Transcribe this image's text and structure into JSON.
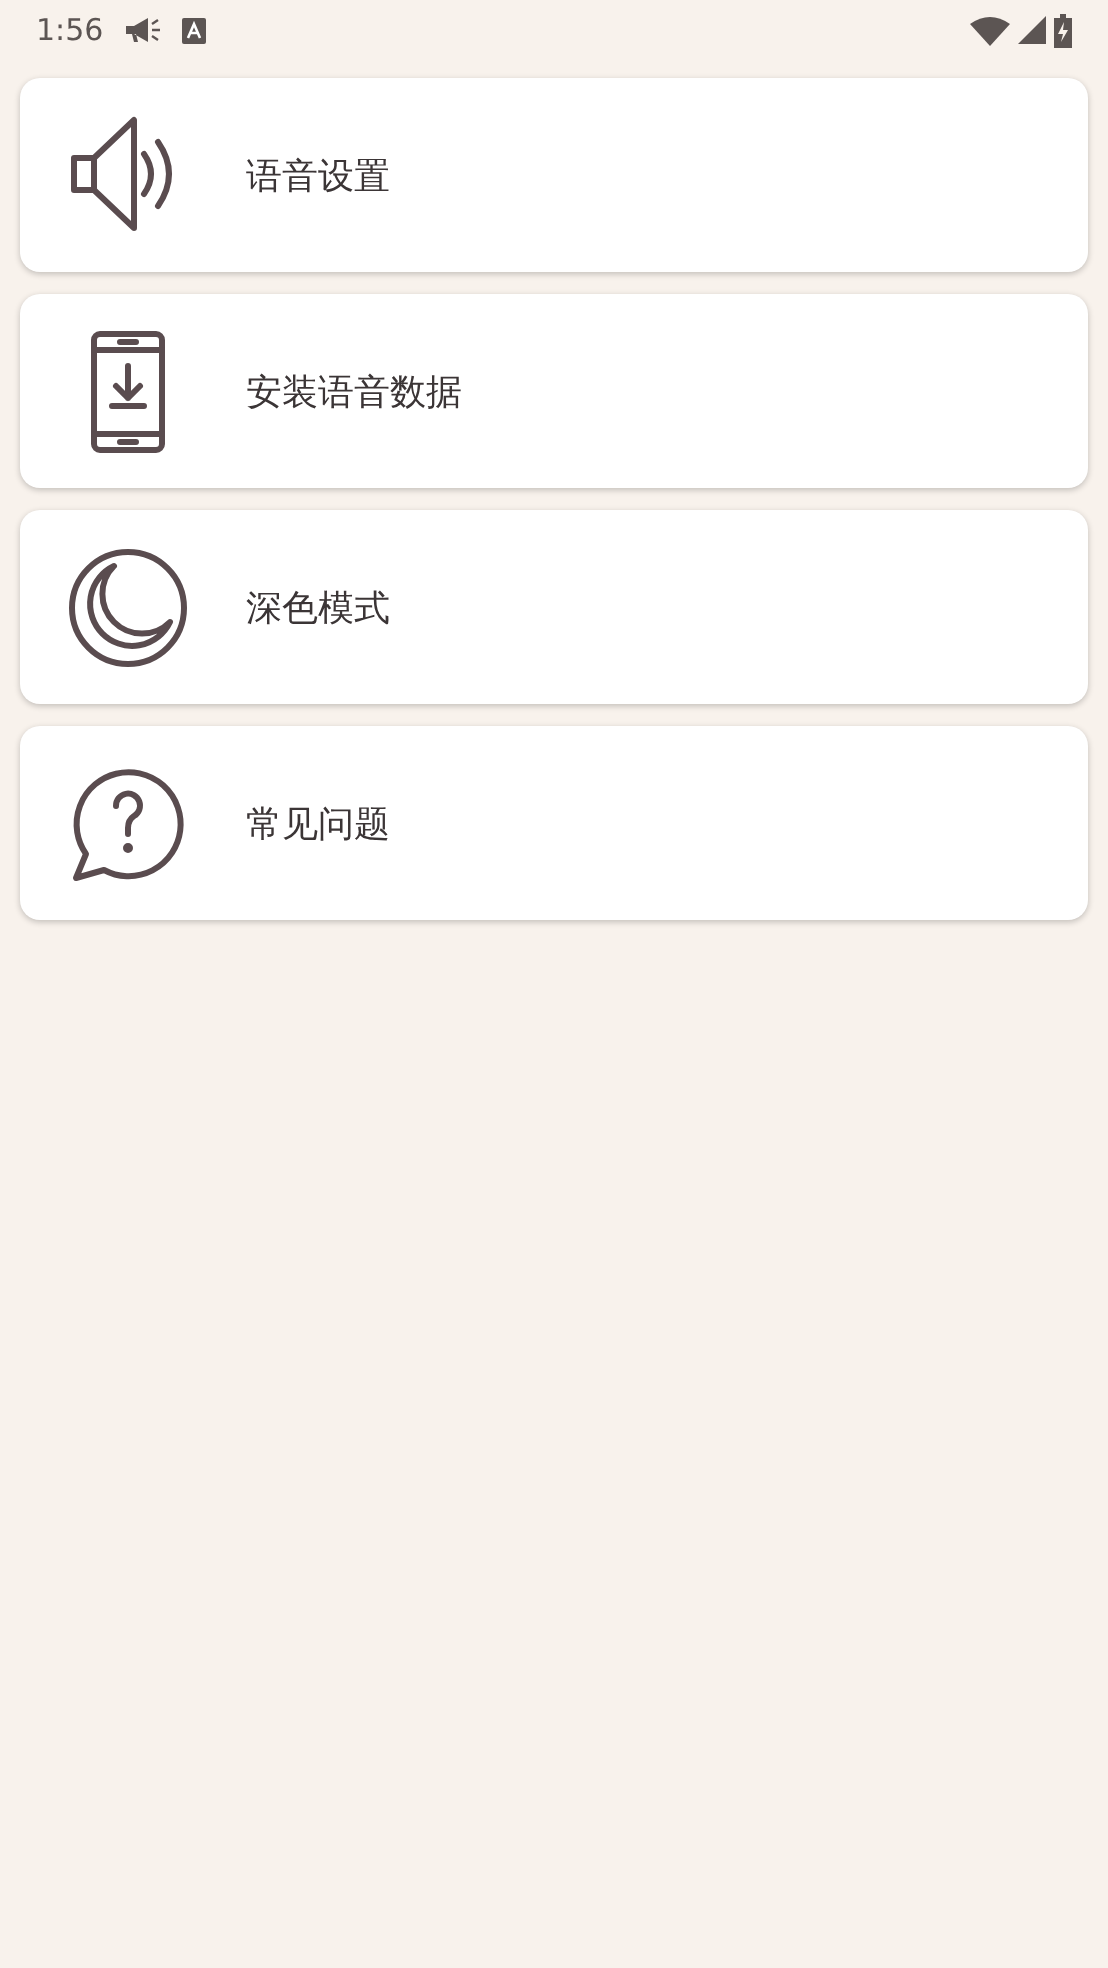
{
  "status_bar": {
    "time": "1:56"
  },
  "items": [
    {
      "label": "语音设置"
    },
    {
      "label": "安装语音数据"
    },
    {
      "label": "深色模式"
    },
    {
      "label": "常见问题"
    }
  ]
}
